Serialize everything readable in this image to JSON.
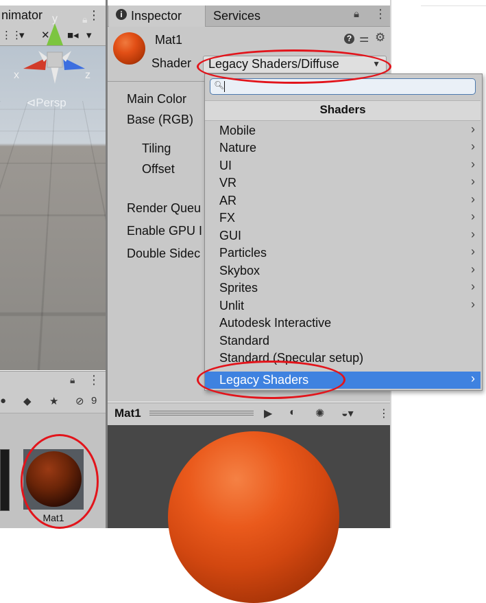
{
  "left_panel": {
    "tab_label": "nimator",
    "kebab": "⋮",
    "persp_label": "Persp",
    "gizmo": {
      "y": "y",
      "x": "x",
      "z": "z"
    },
    "filter_count": "9",
    "asset_label": "Mat1"
  },
  "inspector": {
    "tab_label": "Inspector",
    "services_tab": "Services",
    "material_name": "Mat1",
    "shader_label": "Shader",
    "shader_value": "Legacy Shaders/Diffuse",
    "properties": {
      "main_color": "Main Color",
      "base_rgb": "Base (RGB)",
      "tiling": "Tiling",
      "offset": "Offset",
      "render_queue": "Render Queu",
      "enable_gpu": "Enable GPU I",
      "double_sided": "Double Sidec"
    }
  },
  "preview": {
    "title": "Mat1"
  },
  "shader_menu": {
    "header": "Shaders",
    "search_value": "",
    "items": [
      {
        "label": "Mobile",
        "submenu": true
      },
      {
        "label": "Nature",
        "submenu": true
      },
      {
        "label": "UI",
        "submenu": true
      },
      {
        "label": "VR",
        "submenu": true
      },
      {
        "label": "AR",
        "submenu": true
      },
      {
        "label": "FX",
        "submenu": true
      },
      {
        "label": "GUI",
        "submenu": true
      },
      {
        "label": "Particles",
        "submenu": true
      },
      {
        "label": "Skybox",
        "submenu": true
      },
      {
        "label": "Sprites",
        "submenu": true
      },
      {
        "label": "Unlit",
        "submenu": true
      },
      {
        "label": "Autodesk Interactive",
        "submenu": false
      },
      {
        "label": "Standard",
        "submenu": false
      },
      {
        "label": "Standard (Specular setup)",
        "submenu": false
      },
      {
        "label": "Legacy Shaders",
        "submenu": true
      }
    ],
    "selected_item": "Legacy Shaders"
  },
  "colors": {
    "annotation_red": "#e2141b",
    "selection_blue": "#3f82e0",
    "material_orange": "#e24f16"
  }
}
